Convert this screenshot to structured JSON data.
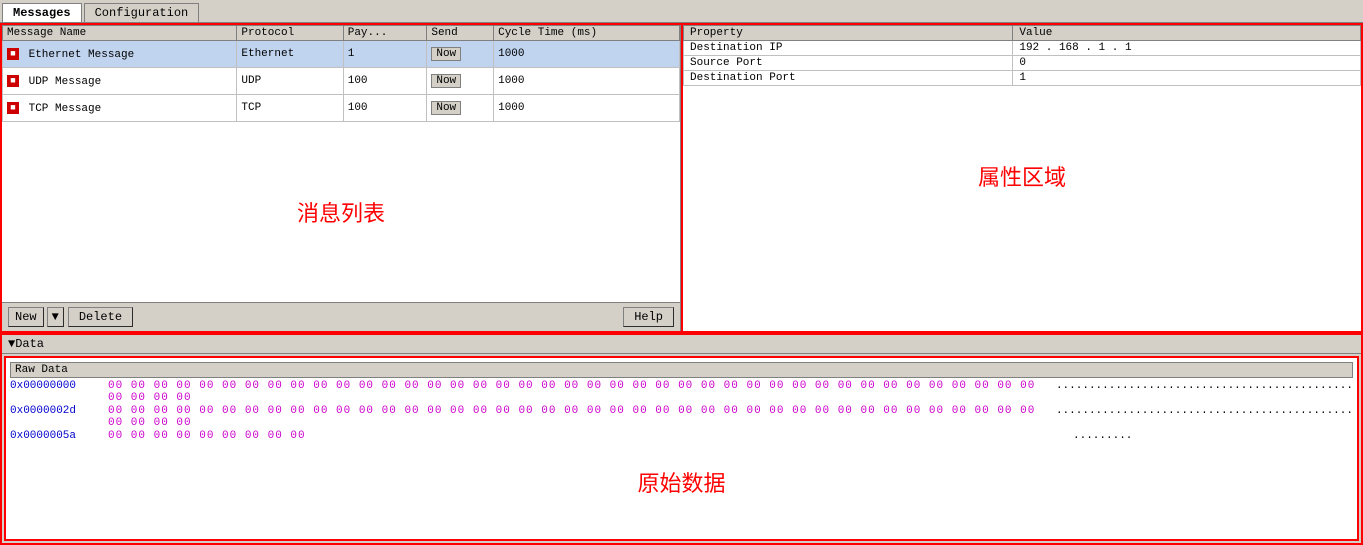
{
  "tabs": [
    {
      "id": "messages",
      "label": "Messages",
      "active": true
    },
    {
      "id": "configuration",
      "label": "Configuration",
      "active": false
    }
  ],
  "messages_panel": {
    "label": "消息列表",
    "table": {
      "columns": [
        "Message Name",
        "Protocol",
        "Pay...",
        "Send",
        "Cycle Time (ms)"
      ],
      "rows": [
        {
          "name": "Ethernet Message",
          "protocol": "Ethernet",
          "payload": "1",
          "send": "Now",
          "cycle": "1000",
          "selected": true
        },
        {
          "name": "UDP Message",
          "protocol": "UDP",
          "payload": "100",
          "send": "Now",
          "cycle": "1000",
          "selected": false
        },
        {
          "name": "TCP Message",
          "protocol": "TCP",
          "payload": "100",
          "send": "Now",
          "cycle": "1000",
          "selected": false
        }
      ]
    },
    "buttons": {
      "new": "New",
      "delete": "Delete",
      "help": "Help"
    }
  },
  "properties_panel": {
    "label": "属性区域",
    "columns": [
      "Property",
      "Value"
    ],
    "rows": [
      {
        "property": "Destination IP",
        "value": "192 . 168 . 1 . 1"
      },
      {
        "property": "Source Port",
        "value": "0"
      },
      {
        "property": "Destination Port",
        "value": "1"
      }
    ]
  },
  "data_section": {
    "header": "▼Data",
    "raw_data_header": "Raw Data",
    "label": "原始数据",
    "rows": [
      {
        "addr": "0x00000000",
        "hex": "00 00 00 00 00 00 00 00 00 00 00 00 00 00 00 00 00 00 00 00 00 00 00 00 00 00 00 00 00 00 00 00 00 00 00 00 00 00 00 00 00 00 00 00 00",
        "ascii": "............................................."
      },
      {
        "addr": "0x0000002d",
        "hex": "00 00 00 00 00 00 00 00 00 00 00 00 00 00 00 00 00 00 00 00 00 00 00 00 00 00 00 00 00 00 00 00 00 00 00 00 00 00 00 00 00 00 00 00 00",
        "ascii": "............................................."
      },
      {
        "addr": "0x0000005a",
        "hex": "00 00 00 00 00 00 00 00 00",
        "ascii": "........."
      }
    ]
  }
}
